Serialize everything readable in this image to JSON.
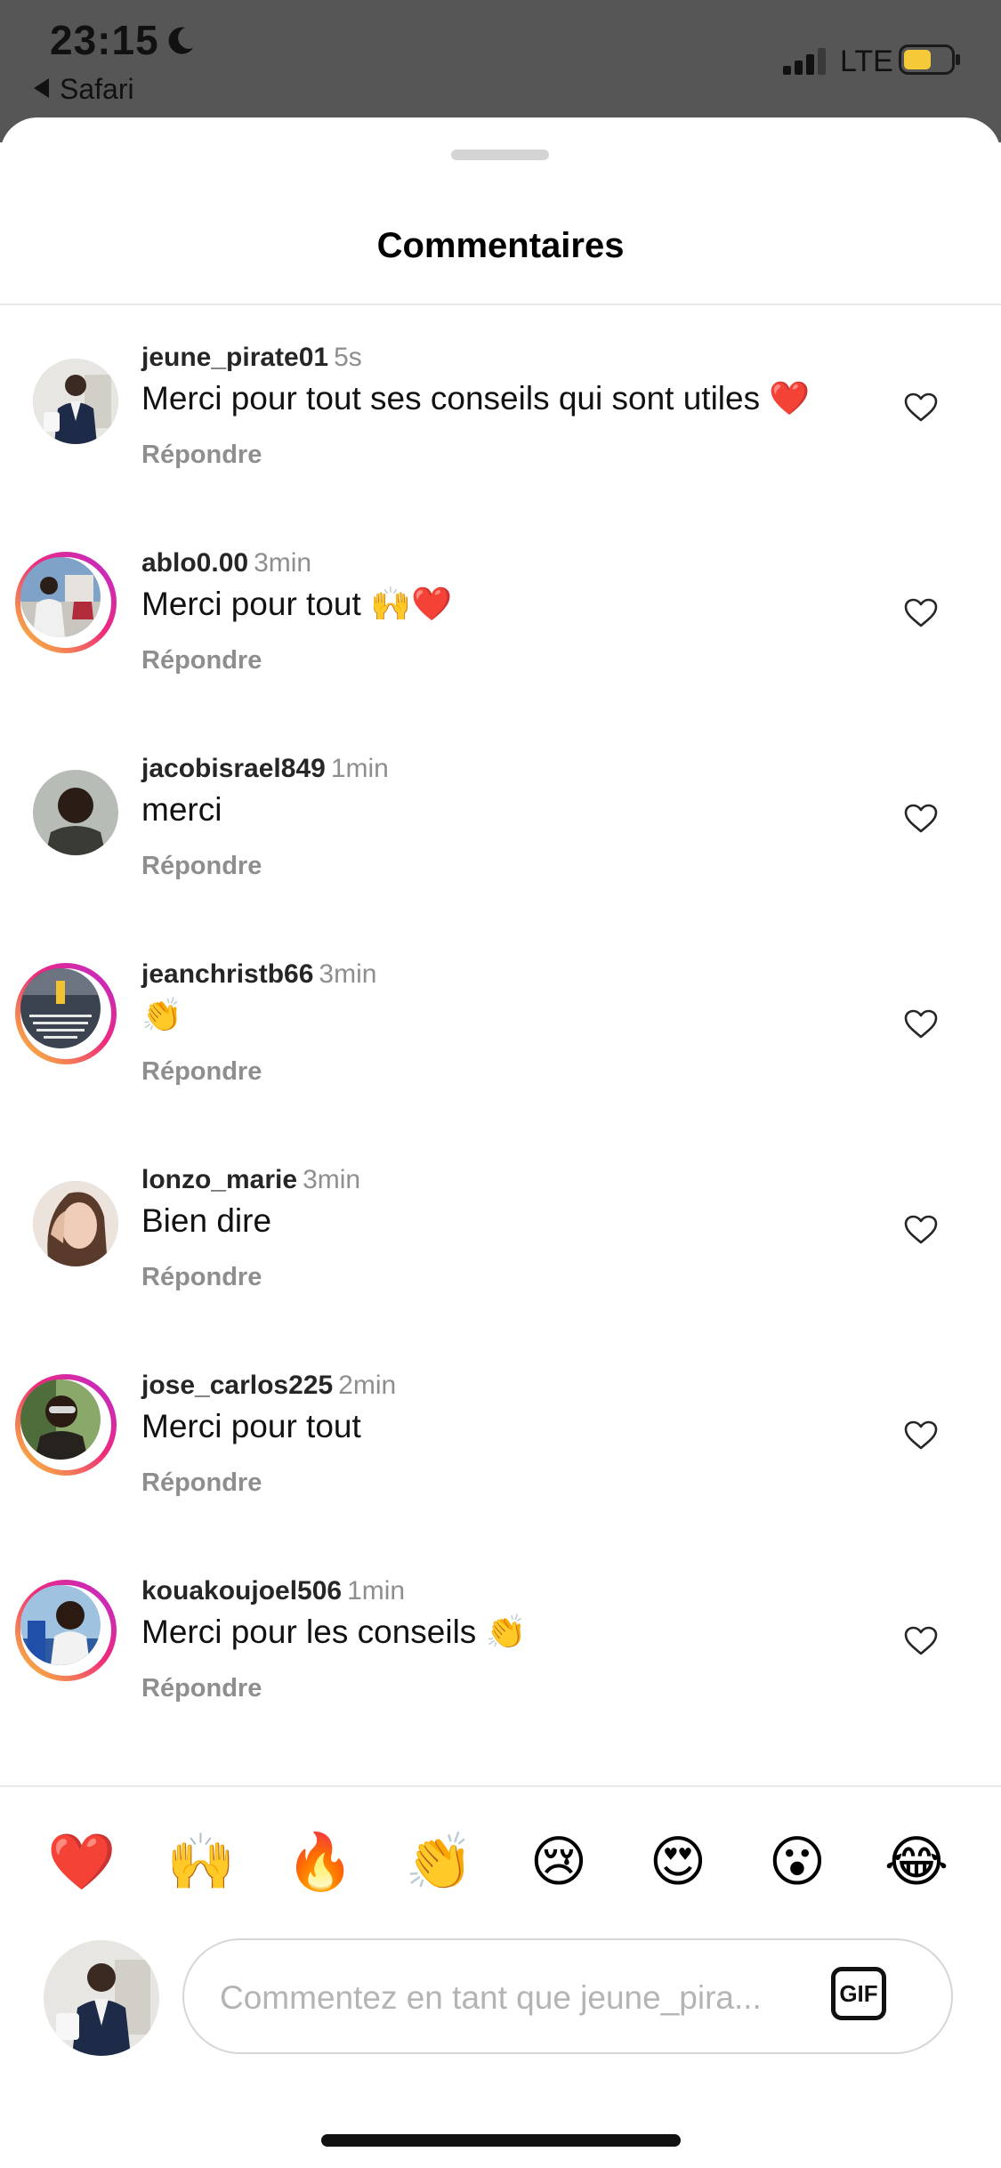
{
  "status_bar": {
    "time": "23:15",
    "back_app": "Safari",
    "network": "LTE"
  },
  "sheet": {
    "title": "Commentaires"
  },
  "comments": [
    {
      "username": "jeune_pirate01",
      "age": "5s",
      "text": "Merci pour tout ses conseils qui sont utiles ❤️",
      "reply": "Répondre",
      "story_ring": false
    },
    {
      "username": "ablo0.00",
      "age": "3min",
      "text": "Merci pour tout 🙌❤️",
      "reply": "Répondre",
      "story_ring": true
    },
    {
      "username": "jacobisrael849",
      "age": "1min",
      "text": "merci",
      "reply": "Répondre",
      "story_ring": false
    },
    {
      "username": "jeanchristb66",
      "age": "3min",
      "text": "👏",
      "reply": "Répondre",
      "story_ring": true
    },
    {
      "username": "lonzo_marie",
      "age": "3min",
      "text": "Bien dire",
      "reply": "Répondre",
      "story_ring": false
    },
    {
      "username": "jose_carlos225",
      "age": "2min",
      "text": "Merci pour tout",
      "reply": "Répondre",
      "story_ring": true
    },
    {
      "username": "kouakoujoel506",
      "age": "1min",
      "text": "Merci pour les conseils 👏",
      "reply": "Répondre",
      "story_ring": true
    }
  ],
  "quick_reactions": [
    "❤️",
    "🙌",
    "🔥",
    "👏",
    "😢",
    "😍",
    "😮",
    "😂"
  ],
  "composer": {
    "placeholder": "Commentez en tant que jeune_pira...",
    "gif_label": "GIF"
  },
  "colors": {
    "ring_start": "#f9ce34",
    "ring_mid": "#ee2a7b",
    "ring_end": "#b92bd6",
    "secondary_text": "#8e8e8e",
    "status_bar_bg": "#565656",
    "battery_fill": "#f5c938"
  }
}
